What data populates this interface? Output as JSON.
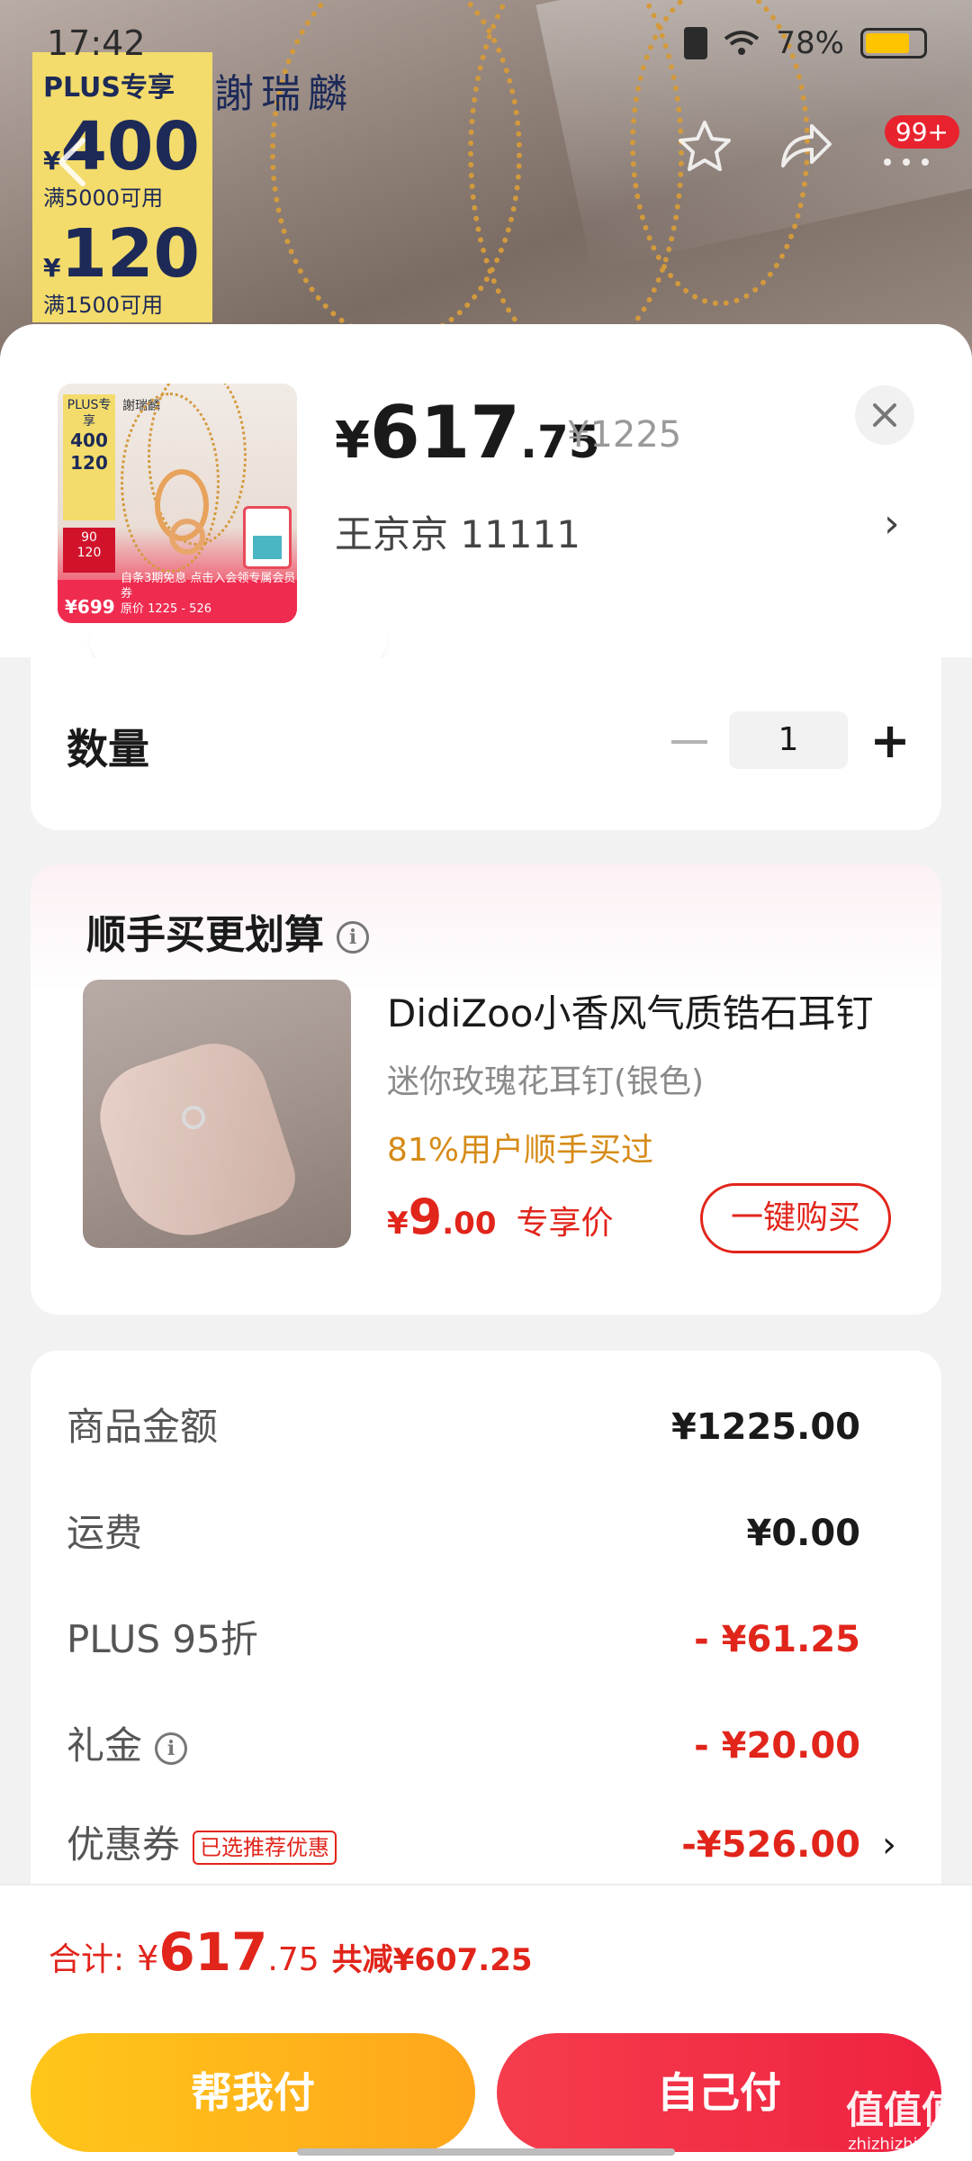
{
  "status_bar": {
    "time": "17:42",
    "battery": "78%",
    "battery_level": 0.78
  },
  "background": {
    "plus_card": {
      "title": "PLUS专享",
      "coupon1_amount": "400",
      "coupon1_cond": "满5000可用",
      "coupon2_amount": "120",
      "coupon2_cond": "满1500可用",
      "yen": "¥"
    },
    "brand": "謝瑞麟",
    "badge": "99+"
  },
  "product": {
    "price_yen": "¥",
    "price_int": "617",
    "price_dec": ".75",
    "original_price": "¥1225",
    "address": "王京京  11111",
    "thumb": {
      "plus": "PLUS专享",
      "amt1": "400",
      "amt2": "120",
      "red1": "90",
      "red2": "120",
      "price": "¥699",
      "line1": "自条3期免息  点击入会领专属会员券",
      "line2": "原价 1225 - 526",
      "brand": "謝瑞麟"
    }
  },
  "quantity": {
    "label": "数量",
    "value": "1",
    "minus": "−",
    "plus": "+"
  },
  "upsell": {
    "title": "顺手买更划算",
    "info": "i",
    "name": "DidiZoo小香风气质锆石耳钉",
    "spec": "迷你玫瑰花耳钉(银色)",
    "stat": "81%用户顺手买过",
    "price_yen": "¥",
    "price_int": "9",
    "price_dec": ".00",
    "price_tag": "专享价",
    "buy_button": "一键购买"
  },
  "fees": [
    {
      "label": "商品金额",
      "value": "¥1225.00",
      "red": false
    },
    {
      "label": "运费",
      "value": "¥0.00",
      "red": false
    },
    {
      "label": "PLUS 95折",
      "value": "- ¥61.25",
      "red": true
    },
    {
      "label": "礼金",
      "value": "- ¥20.00",
      "red": true,
      "info": "i"
    },
    {
      "label": "优惠券",
      "value": "-¥526.00",
      "red": true,
      "tag": "已选推荐优惠",
      "arrow": "›"
    }
  ],
  "footer": {
    "total_label": "合计:",
    "total_yen": "¥",
    "total_int": "617",
    "total_dec": ".75",
    "total_saved": "共减¥607.25",
    "pay_friend": "帮我付",
    "pay_self": "自己付"
  },
  "watermark": {
    "title": "值值值",
    "url": "zhizhizhi.com"
  },
  "colors": {
    "accent_red": "#e1251b",
    "gold": "#d68b17",
    "yellow_btn": "#ffc619",
    "red_btn": "#f53d4c"
  }
}
